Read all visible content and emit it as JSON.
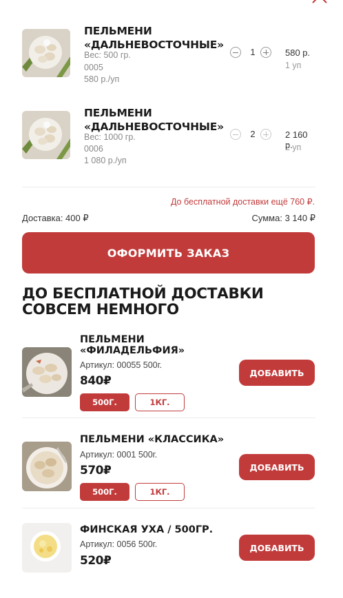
{
  "cart": {
    "items": [
      {
        "title": "ПЕЛЬМЕНИ «ДАЛЬНЕВОСТОЧНЫЕ»",
        "weight": "Вес: 500 гр.",
        "code": "0005",
        "unit_price": "580 р./уп",
        "qty": "1",
        "total": "580 р.",
        "units": "1 уп",
        "image_icon": "dumplings-plate-image"
      },
      {
        "title": "ПЕЛЬМЕНИ «ДАЛЬНЕВОСТОЧНЫЕ»",
        "weight": "Вес: 1000 гр.",
        "code": "0006",
        "unit_price": "1 080 р./уп",
        "qty": "2",
        "total": "2 160 р.",
        "units": "2 уп",
        "image_icon": "dumplings-plate-image"
      }
    ],
    "free_delivery_note": "До бесплатной доставки ещё 760 ₽.",
    "delivery": "Доставка: 400 ₽",
    "sum": "Сумма: 3 140 ₽",
    "checkout_label": "ОФОРМИТЬ ЗАКАЗ"
  },
  "recommend": {
    "title": "ДО БЕСПЛАТНОЙ ДОСТАВКИ СОВСЕМ НЕМНОГО",
    "items": [
      {
        "title": "ПЕЛЬМЕНИ «ФИЛАДЕЛЬФИЯ»",
        "article": "Артикул: 00055  500г.",
        "price": "840₽",
        "add_label": "ДОБАВИТЬ",
        "weights": [
          "500Г.",
          "1КГ."
        ],
        "selected_weight": "500Г."
      },
      {
        "title": "ПЕЛЬМЕНИ «КЛАССИКА»",
        "article": "Артикул: 0001  500г.",
        "price": "570₽",
        "add_label": "ДОБАВИТЬ",
        "weights": [
          "500Г.",
          "1КГ."
        ],
        "selected_weight": "500Г."
      },
      {
        "title": "ФИНСКАЯ УХА / 500ГР.",
        "article": "Артикул: 0056  500г.",
        "price": "520₽",
        "add_label": "ДОБАВИТЬ"
      }
    ]
  },
  "colors": {
    "accent": "#c23b3b",
    "muted_text": "#888888",
    "divider": "#ececec"
  }
}
